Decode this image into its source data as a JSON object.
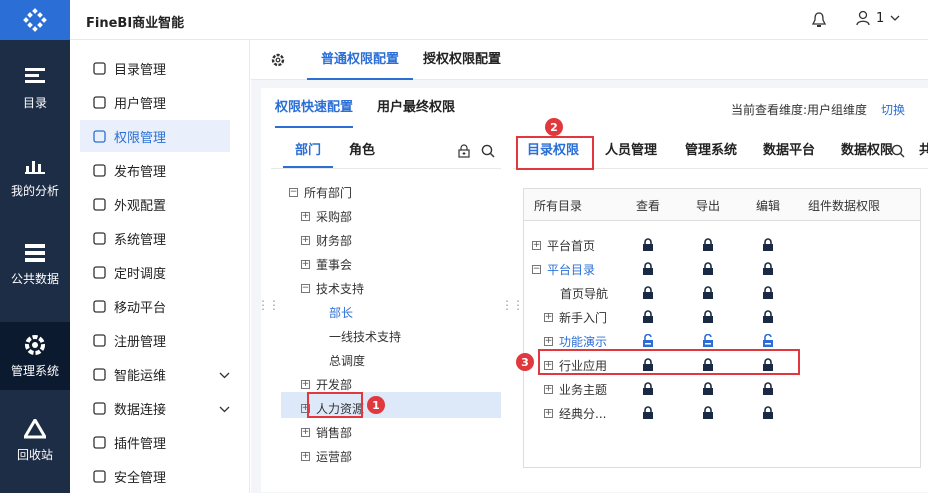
{
  "app": {
    "title": "FineBI商业智能",
    "user": "1"
  },
  "leftnav": [
    {
      "label": "目录",
      "icon": "catalog-icon"
    },
    {
      "label": "我的分析",
      "icon": "analysis-icon"
    },
    {
      "label": "公共数据",
      "icon": "public-data-icon"
    },
    {
      "label": "管理系统",
      "icon": "gear-icon",
      "active": true
    },
    {
      "label": "回收站",
      "icon": "recycle-icon"
    }
  ],
  "menu": [
    {
      "label": "目录管理"
    },
    {
      "label": "用户管理"
    },
    {
      "label": "权限管理",
      "active": true
    },
    {
      "label": "发布管理"
    },
    {
      "label": "外观配置"
    },
    {
      "label": "系统管理"
    },
    {
      "label": "定时调度"
    },
    {
      "label": "移动平台"
    },
    {
      "label": "注册管理"
    },
    {
      "label": "智能运维",
      "expand": true
    },
    {
      "label": "数据连接",
      "expand": true
    },
    {
      "label": "插件管理"
    },
    {
      "label": "安全管理"
    }
  ],
  "tabs": {
    "normal": "普通权限配置",
    "grant": "授权权限配置"
  },
  "subtabs": {
    "quick": "权限快速配置",
    "final": "用户最终权限"
  },
  "dimension": {
    "text": "当前查看维度:用户组维度",
    "switch": "切换"
  },
  "left_tabs": {
    "dept": "部门",
    "role": "角色"
  },
  "tree": [
    {
      "label": "所有部门",
      "box": "−"
    },
    {
      "label": "采购部",
      "box": "+"
    },
    {
      "label": "财务部",
      "box": "+"
    },
    {
      "label": "董事会",
      "box": "+"
    },
    {
      "label": "技术支持",
      "box": "−"
    },
    {
      "label": "部长",
      "box": ""
    },
    {
      "label": "一线技术支持",
      "box": ""
    },
    {
      "label": "总调度",
      "box": ""
    },
    {
      "label": "开发部",
      "box": "+"
    },
    {
      "label": "人力资源",
      "box": "+"
    },
    {
      "label": "销售部",
      "box": "+"
    },
    {
      "label": "运营部",
      "box": "+"
    }
  ],
  "right_tabs": [
    "目录权限",
    "人员管理",
    "管理系统",
    "数据平台",
    "数据权限",
    "共"
  ],
  "grid_headers": [
    "所有目录",
    "查看",
    "导出",
    "编辑",
    "组件数据权限"
  ],
  "grid_rows": [
    {
      "label": "平台首页",
      "box": "+",
      "locked": true
    },
    {
      "label": "平台目录",
      "box": "−",
      "locked": true,
      "blue": true
    },
    {
      "label": "首页导航",
      "box": "",
      "locked": true
    },
    {
      "label": "新手入门",
      "box": "+",
      "locked": true
    },
    {
      "label": "功能演示",
      "box": "+",
      "locked": false,
      "blue": true
    },
    {
      "label": "行业应用",
      "box": "+",
      "locked": true
    },
    {
      "label": "业务主题",
      "box": "+",
      "locked": true
    },
    {
      "label": "经典分...",
      "box": "+",
      "locked": true
    }
  ],
  "badges": [
    "1",
    "2",
    "3"
  ],
  "colors": {
    "accent": "#2b6fd6",
    "nav": "#1d2d45",
    "red": "#e0383d"
  }
}
